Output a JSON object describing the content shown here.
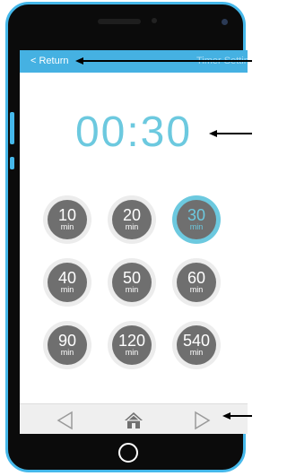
{
  "header": {
    "return_label": "< Return",
    "title": "Timer Setting"
  },
  "timer": {
    "display": "00:30"
  },
  "durations": [
    {
      "value": "10",
      "unit": "min",
      "selected": false
    },
    {
      "value": "20",
      "unit": "min",
      "selected": false
    },
    {
      "value": "30",
      "unit": "min",
      "selected": true
    },
    {
      "value": "40",
      "unit": "min",
      "selected": false
    },
    {
      "value": "50",
      "unit": "min",
      "selected": false
    },
    {
      "value": "60",
      "unit": "min",
      "selected": false
    },
    {
      "value": "90",
      "unit": "min",
      "selected": false
    },
    {
      "value": "120",
      "unit": "min",
      "selected": false
    },
    {
      "value": "540",
      "unit": "min",
      "selected": false
    }
  ],
  "navbar": {
    "items": [
      "back-icon",
      "home-icon",
      "forward-icon"
    ]
  },
  "colors": {
    "accent": "#6cc9df",
    "header": "#45b1e2",
    "button": "#6f6f6f",
    "phone_frame": "#45b8ea"
  }
}
